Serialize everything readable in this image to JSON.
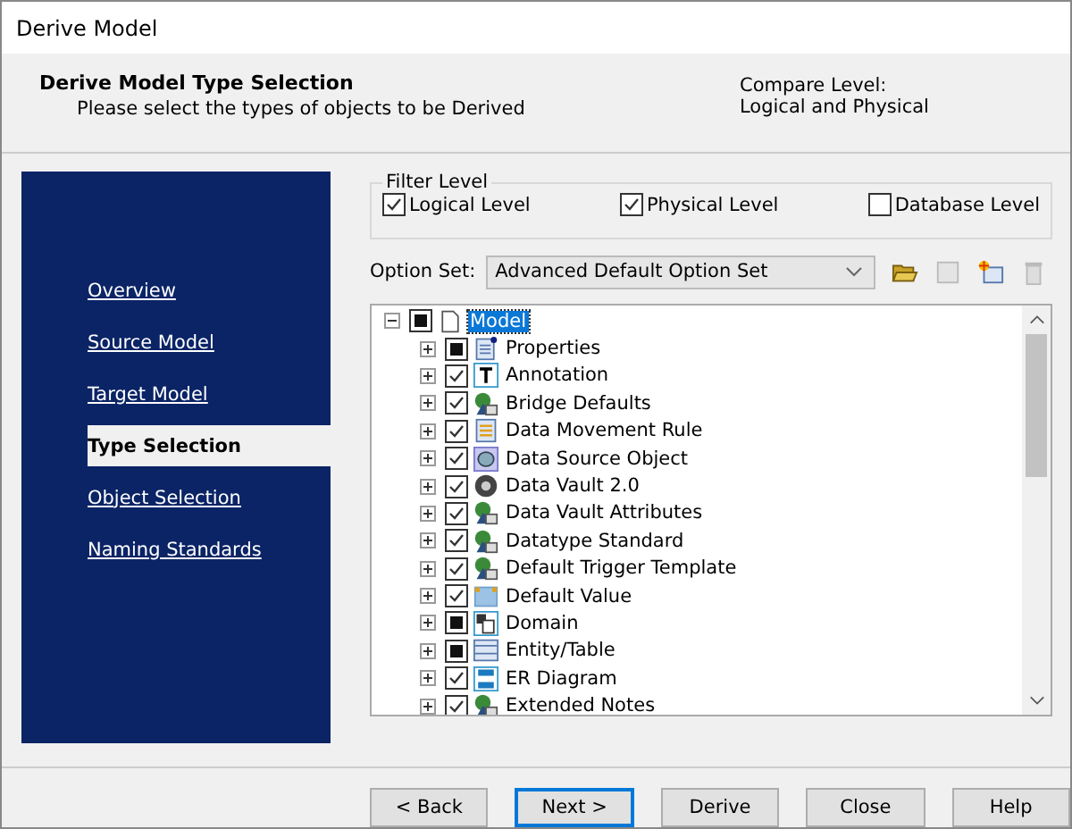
{
  "window": {
    "title": "Derive Model"
  },
  "header": {
    "title": "Derive Model Type Selection",
    "subtitle": "Please select the types of objects to be Derived",
    "compare_label": "Compare Level:",
    "compare_value": "Logical and Physical"
  },
  "sidebar": {
    "items": [
      {
        "label": "Overview",
        "selected": false
      },
      {
        "label": "Source Model",
        "selected": false
      },
      {
        "label": "Target Model",
        "selected": false
      },
      {
        "label": "Type Selection",
        "selected": true
      },
      {
        "label": "Object Selection",
        "selected": false
      },
      {
        "label": "Naming Standards",
        "selected": false
      }
    ]
  },
  "filter_level": {
    "title": "Filter Level",
    "options": [
      {
        "label": "Logical Level",
        "checked": true
      },
      {
        "label": "Physical Level",
        "checked": true
      },
      {
        "label": "Database Level",
        "checked": false
      }
    ]
  },
  "option_set": {
    "label": "Option Set:",
    "value": "Advanced Default Option Set"
  },
  "tree": {
    "label": "Model",
    "checked": false,
    "indeterminate": true,
    "expanded": true,
    "selected": true,
    "children": [
      {
        "label": "Properties",
        "checked": false,
        "indeterminate": true,
        "expanded": false
      },
      {
        "label": "Annotation",
        "checked": true,
        "indeterminate": false,
        "expanded": false
      },
      {
        "label": "Bridge Defaults",
        "checked": true,
        "indeterminate": false,
        "expanded": false
      },
      {
        "label": "Data Movement Rule",
        "checked": true,
        "indeterminate": false,
        "expanded": false
      },
      {
        "label": "Data Source Object",
        "checked": true,
        "indeterminate": false,
        "expanded": false
      },
      {
        "label": "Data Vault 2.0",
        "checked": true,
        "indeterminate": false,
        "expanded": false
      },
      {
        "label": "Data Vault Attributes",
        "checked": true,
        "indeterminate": false,
        "expanded": false
      },
      {
        "label": "Datatype Standard",
        "checked": true,
        "indeterminate": false,
        "expanded": false
      },
      {
        "label": "Default Trigger Template",
        "checked": true,
        "indeterminate": false,
        "expanded": false
      },
      {
        "label": "Default Value",
        "checked": true,
        "indeterminate": false,
        "expanded": false
      },
      {
        "label": "Domain",
        "checked": false,
        "indeterminate": true,
        "expanded": false
      },
      {
        "label": "Entity/Table",
        "checked": false,
        "indeterminate": true,
        "expanded": false
      },
      {
        "label": "ER Diagram",
        "checked": true,
        "indeterminate": false,
        "expanded": false
      },
      {
        "label": "Extended Notes",
        "checked": true,
        "indeterminate": false,
        "expanded": false
      }
    ]
  },
  "buttons": [
    {
      "label": "< Back",
      "default": false
    },
    {
      "label": "Next >",
      "default": true
    },
    {
      "label": "Derive",
      "default": false
    },
    {
      "label": "Close",
      "default": false
    },
    {
      "label": "Help",
      "default": false
    }
  ]
}
